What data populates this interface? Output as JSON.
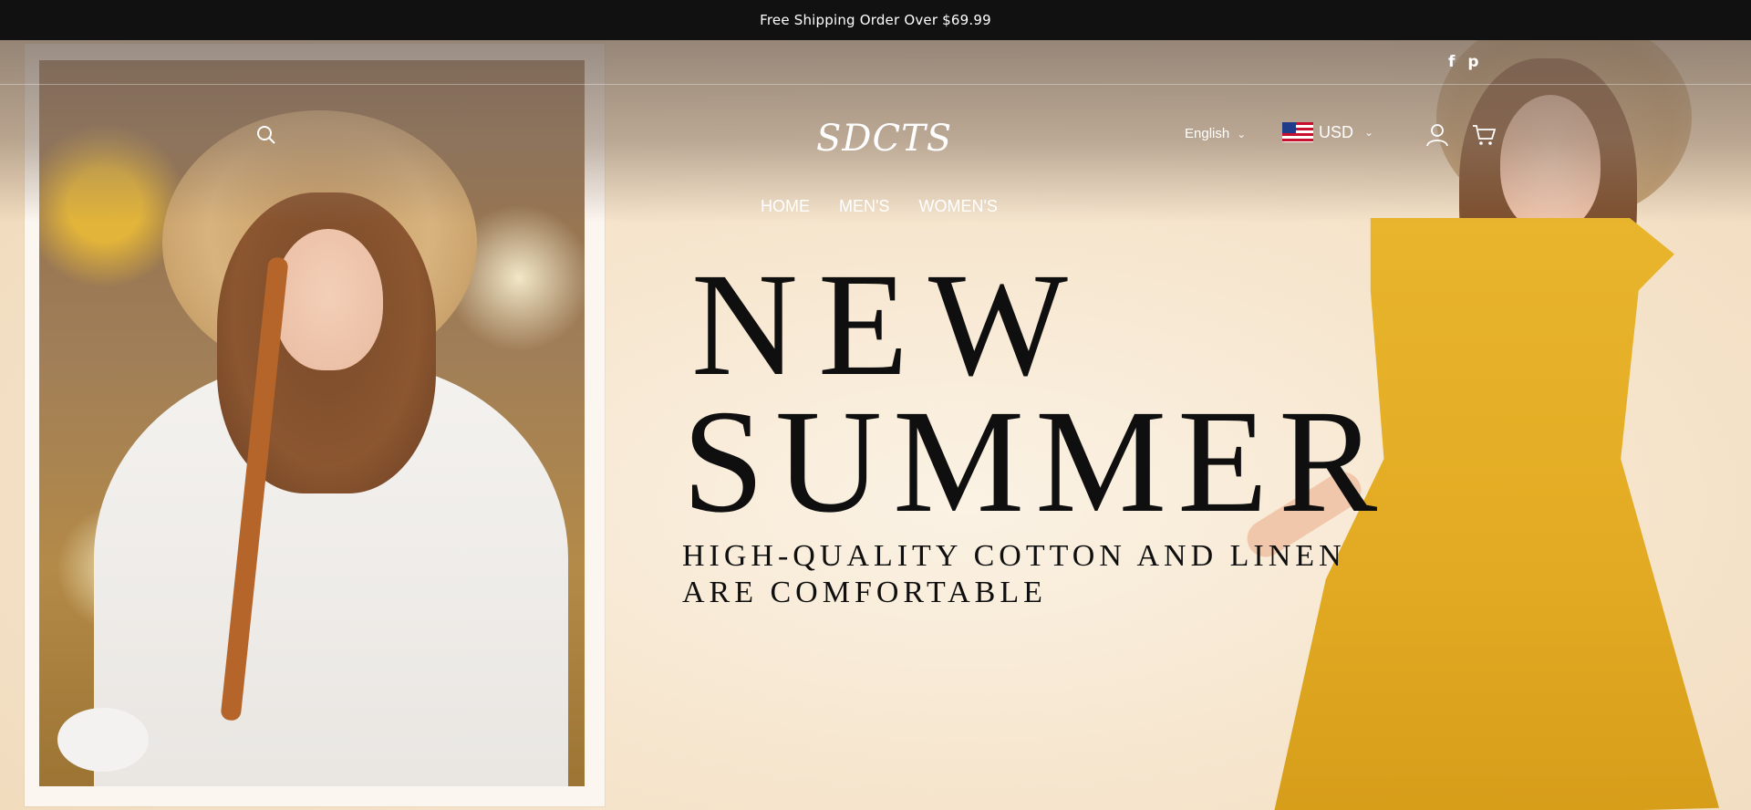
{
  "announcement": {
    "text": "Free Shipping Order Over $69.99"
  },
  "header": {
    "logo": "SDCTS",
    "language": "English",
    "currency": "USD",
    "icons": [
      "search-icon",
      "user-icon",
      "cart-icon"
    ]
  },
  "social": {
    "facebook": "f",
    "pinterest": "p"
  },
  "nav": [
    {
      "label": "HOME"
    },
    {
      "label": "MEN'S"
    },
    {
      "label": "WOMEN'S"
    }
  ],
  "hero": {
    "title_line1": "NEW",
    "title_line2": "SUMMER",
    "subtitle": "HIGH-QUALITY COTTON AND LINEN\nARE COMFORTABLE"
  },
  "colors": {
    "announcement_bg": "#111111",
    "hero_bg": "#f5e6cf",
    "text_dark": "#0f0f0f",
    "accent_yellow": "#e2aa22"
  }
}
